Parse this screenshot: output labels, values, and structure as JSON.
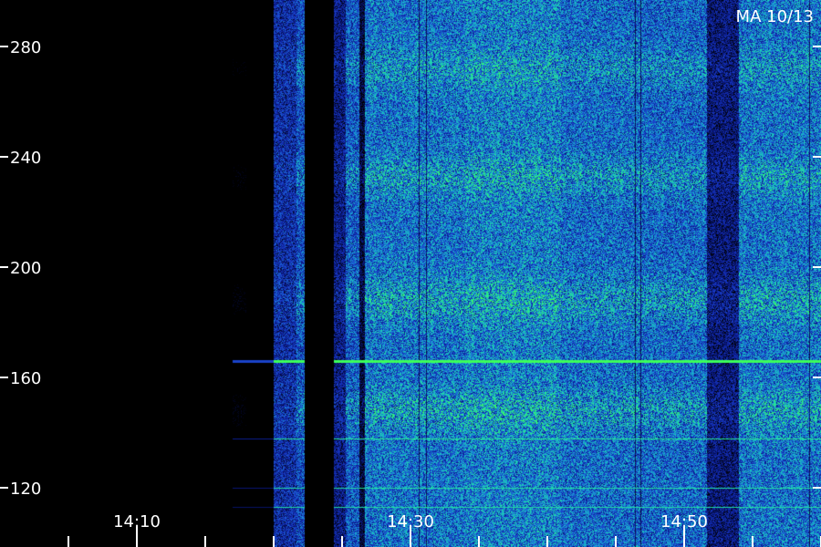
{
  "chart_data": {
    "type": "heatmap",
    "title": "",
    "corner_label": "MA 10/13",
    "xlabel": "",
    "ylabel": "",
    "x_ticks": [
      {
        "value": "14:10",
        "label": "14:10"
      },
      {
        "value": "14:30",
        "label": "14:30"
      },
      {
        "value": "14:50",
        "label": "14:50"
      }
    ],
    "x_minor_ticks": [
      "14:05",
      "14:15",
      "14:20",
      "14:25",
      "14:35",
      "14:40",
      "14:45",
      "14:55",
      "15:00"
    ],
    "xlim": [
      "14:05",
      "15:00"
    ],
    "y_ticks": [
      {
        "value": 120,
        "label": "120"
      },
      {
        "value": 160,
        "label": "160"
      },
      {
        "value": 200,
        "label": "200"
      },
      {
        "value": 240,
        "label": "240"
      },
      {
        "value": 280,
        "label": "280"
      }
    ],
    "ylim": [
      110,
      298
    ],
    "colormap": [
      "#000000",
      "#0a1a8c",
      "#1a3cc8",
      "#1a7ad8",
      "#18b8c8",
      "#22e0a0",
      "#3cff5a"
    ],
    "signal_segments": [
      {
        "start": "14:00",
        "end": "14:17",
        "level": 0.0
      },
      {
        "start": "14:17",
        "end": "14:18",
        "level": 0.12
      },
      {
        "start": "14:18",
        "end": "14:20",
        "level": 0.05
      },
      {
        "start": "14:20",
        "end": "14:21.6",
        "level": 0.55
      },
      {
        "start": "14:21.6",
        "end": "14:22.2",
        "level": 0.7
      },
      {
        "start": "14:22.2",
        "end": "14:24.4",
        "level": 0.0
      },
      {
        "start": "14:24.4",
        "end": "14:25.2",
        "level": 0.45
      },
      {
        "start": "14:25.2",
        "end": "14:26.2",
        "level": 0.75
      },
      {
        "start": "14:26.2",
        "end": "14:26.6",
        "level": 0.3
      },
      {
        "start": "14:26.6",
        "end": "14:34",
        "level": 0.85
      },
      {
        "start": "14:34",
        "end": "14:41",
        "level": 0.9
      },
      {
        "start": "14:41",
        "end": "14:47",
        "level": 0.82
      },
      {
        "start": "14:47",
        "end": "14:51.6",
        "level": 0.8
      },
      {
        "start": "14:51.6",
        "end": "14:54",
        "level": 0.42
      },
      {
        "start": "14:54",
        "end": "15:00",
        "level": 0.85
      }
    ],
    "dark_lines": [
      "14:30.6",
      "14:31.1",
      "14:46.4",
      "14:46.8",
      "14:59.1"
    ],
    "interference_lines": [
      {
        "freq": 166,
        "strength": 1.0
      },
      {
        "freq": 138,
        "strength": 0.5
      },
      {
        "freq": 120,
        "strength": 0.4
      },
      {
        "freq": 113,
        "strength": 0.35
      }
    ],
    "emission_bands": [
      {
        "freq": 148,
        "width": 8,
        "strength": 0.25
      },
      {
        "freq": 188,
        "width": 8,
        "strength": 0.25
      },
      {
        "freq": 233,
        "width": 7,
        "strength": 0.22
      },
      {
        "freq": 272,
        "width": 7,
        "strength": 0.18
      }
    ]
  }
}
